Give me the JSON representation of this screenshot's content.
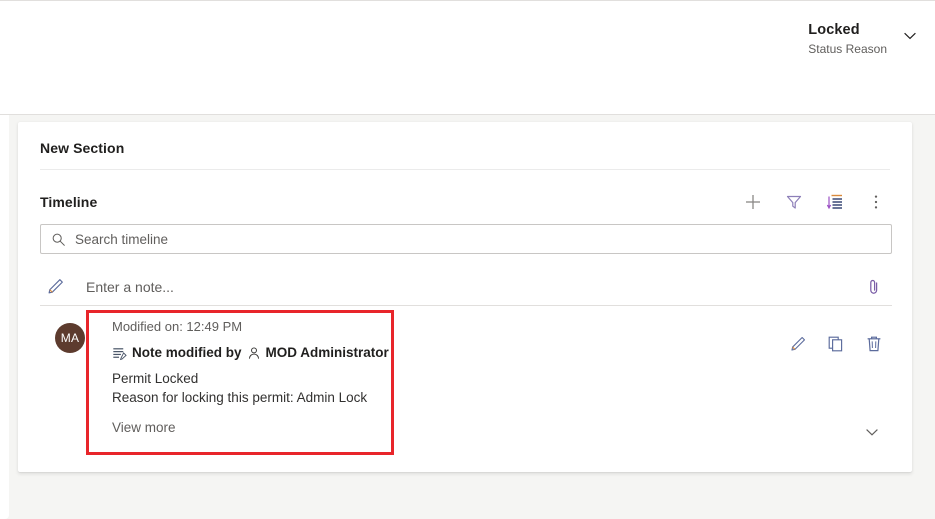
{
  "header": {
    "status_value": "Locked",
    "status_label": "Status Reason",
    "chevron_icon": "chevron-down-icon"
  },
  "card": {
    "section_title": "New Section",
    "timeline": {
      "title": "Timeline",
      "actions": [
        {
          "name": "add-record-button",
          "icon": "plus-icon"
        },
        {
          "name": "filter-button",
          "icon": "filter-icon"
        },
        {
          "name": "sort-button",
          "icon": "sort-icon"
        },
        {
          "name": "more-commands-button",
          "icon": "ellipsis-vertical-icon"
        }
      ],
      "search": {
        "placeholder": "Search timeline",
        "value": "",
        "icon": "search-icon"
      },
      "note_entry": {
        "placeholder": "Enter a note...",
        "value": "",
        "icon": "pencil-icon",
        "attach_icon": "paperclip-icon"
      },
      "items": [
        {
          "avatar_initials": "MA",
          "avatar_color": "#5d3b2e",
          "meta": "Modified on: 12:49 PM",
          "record_icon": "note-icon",
          "subject_prefix": "Note modified by",
          "user_icon": "person-icon",
          "user": "MOD Administrator",
          "lines": [
            "Permit Locked",
            "Reason for locking this permit: Admin Lock"
          ],
          "view_more": "View more",
          "actions": [
            {
              "name": "edit-note-button",
              "icon": "pencil-icon"
            },
            {
              "name": "copy-note-button",
              "icon": "copy-icon"
            },
            {
              "name": "delete-note-button",
              "icon": "trash-icon"
            }
          ],
          "expand_icon": "chevron-down-icon"
        }
      ]
    }
  },
  "annotation": {
    "color": "#e8252a",
    "name": "highlight-rectangle"
  }
}
